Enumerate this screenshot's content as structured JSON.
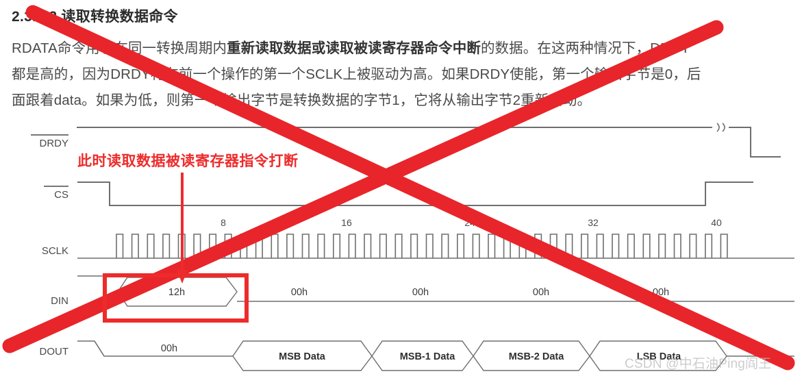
{
  "document": {
    "heading": "2.3.5.2 读取转换数据命令",
    "paragraph_lines": [
      {
        "segments": [
          {
            "text": "RDATA命令用于在同一转换周期内",
            "bold": false
          },
          {
            "text": "重新读取数据或读取被读寄存器命令中断",
            "bold": true
          },
          {
            "text": "的数据。在这两种情况下，DRDY",
            "bold": false
          }
        ]
      },
      {
        "segments": [
          {
            "text": "都是高的，因为DRDY将在前一个操作的第一个SCLK上被驱动为高。如果DRDY使能，第一个输出字节是0，后",
            "bold": false
          }
        ]
      },
      {
        "segments": [
          {
            "text": "面跟着data。如果为低，则第一个输出字节是转换数据的字节1，它将从输出字节2重新启动。",
            "bold": false
          }
        ]
      }
    ]
  },
  "annotation": {
    "text": "此时读取数据被读寄存器指令打断",
    "color": "#ee2b2b",
    "cross_color": "#e8252a",
    "box_color": "#ee2b2b"
  },
  "timing_diagram": {
    "signals": [
      {
        "name": "DRDY",
        "label": "DRDY",
        "overbar": true
      },
      {
        "name": "CS",
        "label": "CS",
        "overbar": true
      },
      {
        "name": "SCLK",
        "label": "SCLK",
        "overbar": false
      },
      {
        "name": "DIN",
        "label": "DIN",
        "overbar": false
      },
      {
        "name": "DOUT",
        "label": "DOUT",
        "overbar": false
      }
    ],
    "sclk_ticks": [
      "8",
      "16",
      "24",
      "32",
      "40"
    ],
    "din_values": [
      "12h",
      "00h",
      "00h",
      "00h",
      "00h"
    ],
    "dout_values": [
      "00h",
      "MSB Data",
      "MSB-1 Data",
      "MSB-2 Data",
      "LSB Data"
    ],
    "break_symbol": "ss"
  },
  "watermark": {
    "text": "CSDN @中石油Ping阎王"
  }
}
